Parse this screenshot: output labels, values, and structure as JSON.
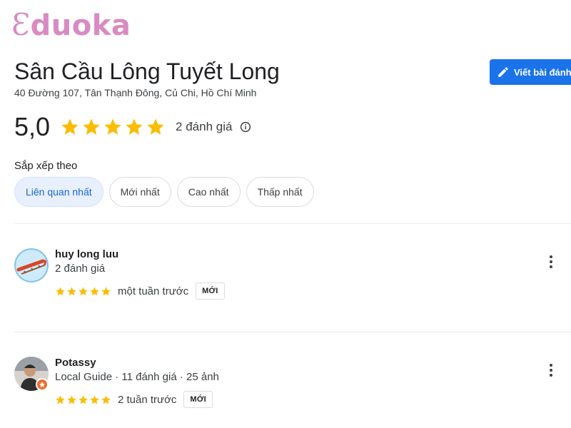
{
  "logo": {
    "first_letter": "Ɛ",
    "rest": "duoka",
    "color": "#d98bc1"
  },
  "place": {
    "title": "Sân Cầu Lông Tuyết Long",
    "address": "40 Đường 107, Tân Thạnh Đông, Củ Chi, Hồ Chí Minh"
  },
  "write_review": {
    "label": "Viết bài đánh",
    "icon": "pencil-icon"
  },
  "summary": {
    "rating": "5,0",
    "stars": 5,
    "review_count": "2 đánh giá",
    "info_icon": "info-icon"
  },
  "sort": {
    "label": "Sắp xếp theo",
    "options": [
      "Liên quan nhất",
      "Mới nhất",
      "Cao nhất",
      "Thấp nhất"
    ],
    "selected": "Liên quan nhất"
  },
  "reviews": [
    {
      "name": "huy long luu",
      "subtitle": "2 đánh giá",
      "stars": 5,
      "time": "một tuần trước",
      "badge": "MỚI",
      "avatar": "sled-avatar"
    },
    {
      "name": "Potassy",
      "subtitle": "Local Guide · 11 đánh giá · 25 ảnh",
      "stars": 5,
      "time": "2 tuần trước",
      "badge": "MỚI",
      "avatar": "person-avatar"
    }
  ],
  "colors": {
    "star": "#fbbc04",
    "accent": "#1a73e8",
    "chip_active_bg": "#e8f0fe",
    "chip_active_text": "#1967d2"
  }
}
